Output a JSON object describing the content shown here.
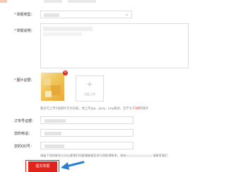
{
  "form": {
    "type_label": "举报类型：",
    "desc_label": "举报说明：",
    "image_label": "图片证据：",
    "upload_text": "点此上传",
    "remove_glyph": "×",
    "caret_glyph": "⌄",
    "hint_prefix": "最多可上传5张图片作为证据，请上传jpg、jpeg、png格式，且不大于",
    "hint_size": "1M",
    "hint_suffix": "的图片",
    "order_label": "订单号证据：",
    "phone_label": "您的电话：",
    "qq_label": "您的QQ号：",
    "notice_prefix": "请留下您的联系方式以便我们的客服能够及时与您取得联系，如有",
    "notice_suffix": "请联系我们",
    "submit_label": "提交举报",
    "required_mark": "*"
  },
  "colors": {
    "accent": "#e0241b",
    "arrow": "#2b7fd3",
    "border": "#dcdcdc"
  }
}
